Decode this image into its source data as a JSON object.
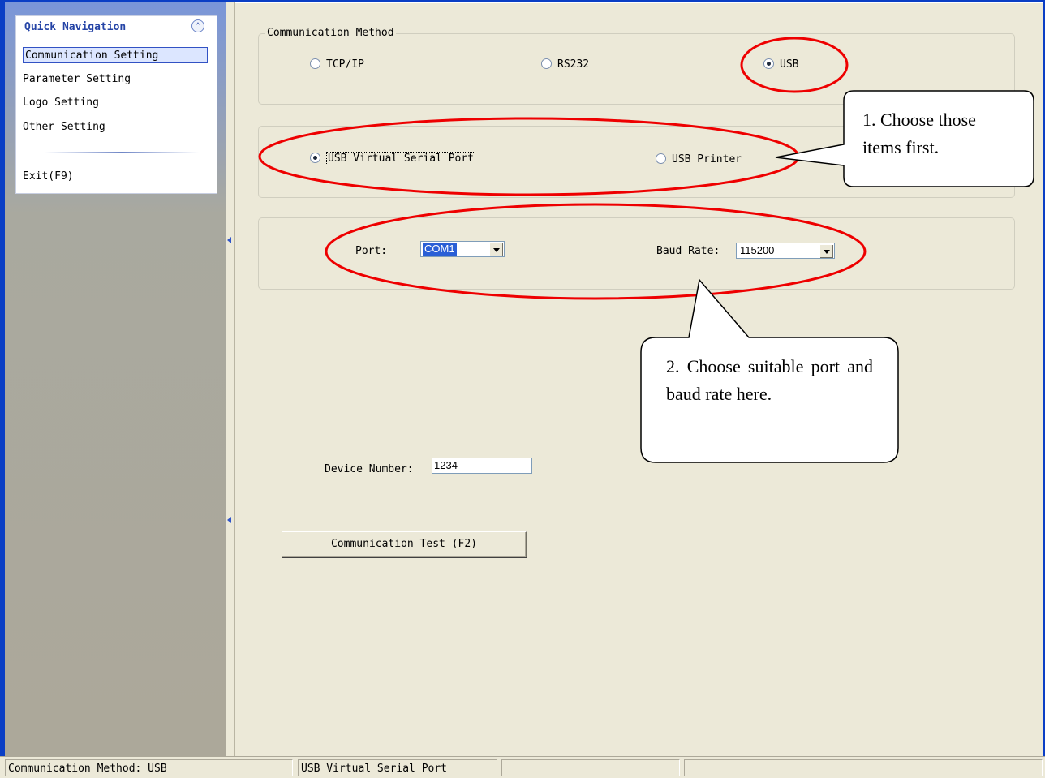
{
  "sidebar": {
    "header": "Quick Navigation",
    "collapse_icon": "chevron-double-up-icon",
    "items": [
      {
        "label": "Communication Setting",
        "active": true
      },
      {
        "label": "Parameter Setting",
        "active": false
      },
      {
        "label": "Logo Setting",
        "active": false
      },
      {
        "label": "Other Setting",
        "active": false
      }
    ],
    "exit_label": "Exit(F9)"
  },
  "communication": {
    "group_title": "Communication Method",
    "methods": [
      {
        "label": "TCP/IP",
        "checked": false
      },
      {
        "label": "RS232",
        "checked": false
      },
      {
        "label": "USB",
        "checked": true
      }
    ],
    "usb_modes": [
      {
        "label": "USB Virtual Serial Port",
        "checked": true
      },
      {
        "label": "USB Printer",
        "checked": false
      }
    ],
    "port_label": "Port:",
    "port_value": "COM1",
    "baud_label": "Baud Rate:",
    "baud_value": "115200",
    "device_label": "Device Number:",
    "device_value": "1234",
    "test_button": "Communication Test (F2)"
  },
  "annotations": {
    "callout1": "1. Choose those items first.",
    "callout2": "2. Choose suitable port and baud rate here.",
    "highlight_color": "#ee0000"
  },
  "statusbar": {
    "method": "Communication Method: USB",
    "mode": "USB Virtual Serial Port",
    "cell3": "",
    "cell4": ""
  },
  "colors": {
    "window_border": "#0a3ec5",
    "panel_bg": "#ece9d8",
    "nav_header": "#2544a6",
    "selection": "#2a5fd6"
  }
}
